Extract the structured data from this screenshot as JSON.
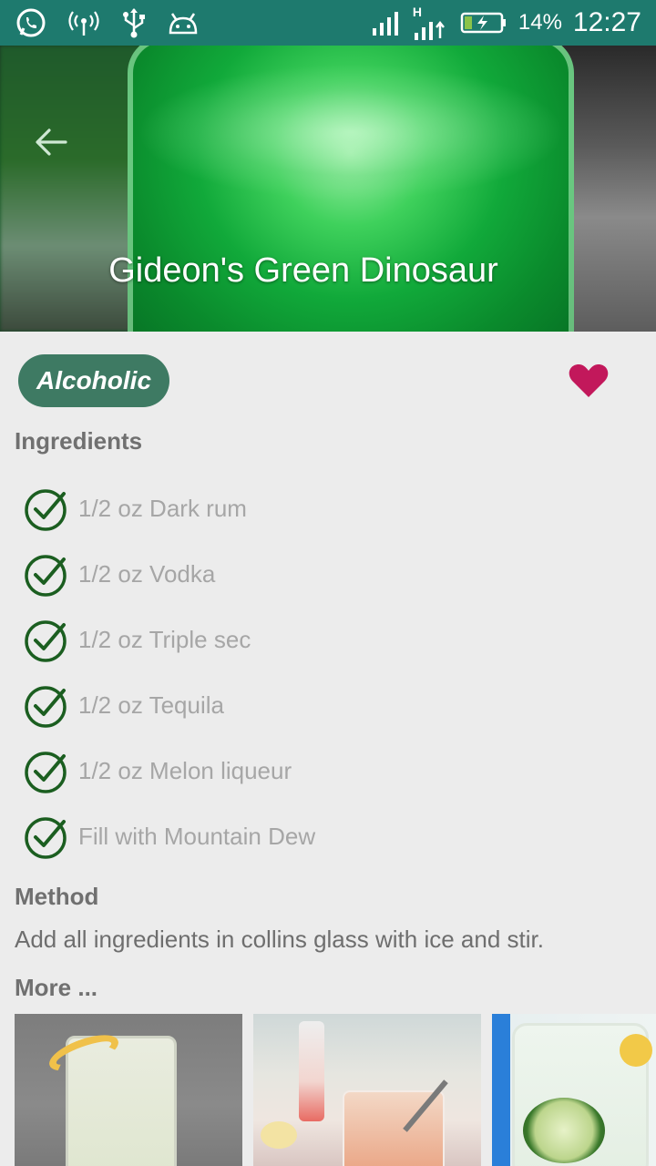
{
  "status_bar": {
    "battery_percent": "14%",
    "time": "12:27",
    "network_type": "H",
    "icons": [
      "whatsapp-icon",
      "hotspot-icon",
      "usb-icon",
      "android-debug-icon",
      "signal-icon",
      "signal-icon",
      "battery-charging-icon"
    ]
  },
  "header": {
    "title": "Gideon's Green Dinosaur",
    "back_icon": "arrow-back-icon"
  },
  "category_tag": "Alcoholic",
  "favorite": {
    "icon": "heart-icon",
    "color": "#c2185b",
    "active": true
  },
  "ingredients": {
    "title": "Ingredients",
    "items": [
      {
        "text": "1/2 oz Dark rum",
        "checked": true
      },
      {
        "text": "1/2 oz Vodka",
        "checked": true
      },
      {
        "text": "1/2 oz Triple sec",
        "checked": true
      },
      {
        "text": "1/2 oz Tequila",
        "checked": true
      },
      {
        "text": "1/2 oz Melon liqueur",
        "checked": true
      },
      {
        "text": "Fill with Mountain Dew",
        "checked": true
      }
    ]
  },
  "method": {
    "title": "Method",
    "text": "Add all ingredients in collins glass with ice and stir."
  },
  "more": {
    "title": "More ..."
  },
  "colors": {
    "status_bar": "#1e7a6e",
    "accent": "#3e7a63",
    "check": "#1b5e20",
    "heart": "#c2185b"
  }
}
